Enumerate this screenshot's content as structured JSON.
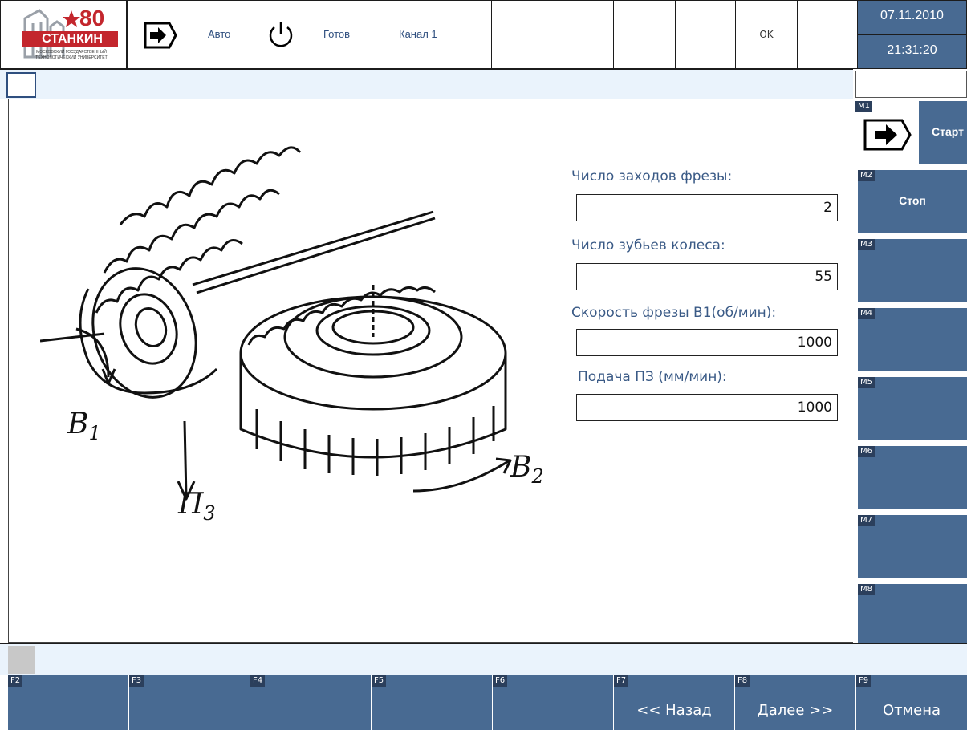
{
  "header": {
    "logo": {
      "number": "80",
      "name": "СТАНКИН",
      "tagline_1": "МОСКОВСКИЙ ГОСУДАРСТВЕННЫЙ",
      "tagline_2": "ТЕХНОЛОГИЧЕСКИЙ УНИВЕРСИТЕТ"
    },
    "mode_icon": "arrow-right-icon",
    "mode_label": "Авто",
    "power_icon": "power-icon",
    "status_label": "Готов",
    "channel_label": "Канал 1",
    "ok_label": "OK",
    "date": "07.11.2010",
    "time": "21:31:20"
  },
  "illustration": {
    "label_b1": "B",
    "label_b1_sub": "1",
    "label_p3": "П",
    "label_p3_sub": "3",
    "label_b2": "B",
    "label_b2_sub": "2"
  },
  "form": {
    "fields": [
      {
        "label": "Число заходов фрезы:",
        "value": "2"
      },
      {
        "label": "Число зубьев колеса:",
        "value": "55"
      },
      {
        "label": "Скорость фрезы В1(об/мин):",
        "value": "1000"
      },
      {
        "label": "Подача ПЗ (мм/мин):",
        "value": "1000"
      }
    ]
  },
  "side_keys": [
    {
      "tag": "M1",
      "label": "Старт",
      "icon": "arrow-right-icon"
    },
    {
      "tag": "M2",
      "label": "Стоп"
    },
    {
      "tag": "M3",
      "label": ""
    },
    {
      "tag": "M4",
      "label": ""
    },
    {
      "tag": "M5",
      "label": ""
    },
    {
      "tag": "M6",
      "label": ""
    },
    {
      "tag": "M7",
      "label": ""
    },
    {
      "tag": "M8",
      "label": ""
    }
  ],
  "bottom_keys": [
    {
      "tag": "F2",
      "label": ""
    },
    {
      "tag": "F3",
      "label": ""
    },
    {
      "tag": "F4",
      "label": ""
    },
    {
      "tag": "F5",
      "label": ""
    },
    {
      "tag": "F6",
      "label": ""
    },
    {
      "tag": "F7",
      "label": "<< Назад"
    },
    {
      "tag": "F8",
      "label": "Далее >>"
    },
    {
      "tag": "F9",
      "label": "Отмена"
    }
  ],
  "colors": {
    "softkey": "#486a92",
    "label_text": "#3a5a86",
    "message_bar": "#eaf3fc"
  }
}
